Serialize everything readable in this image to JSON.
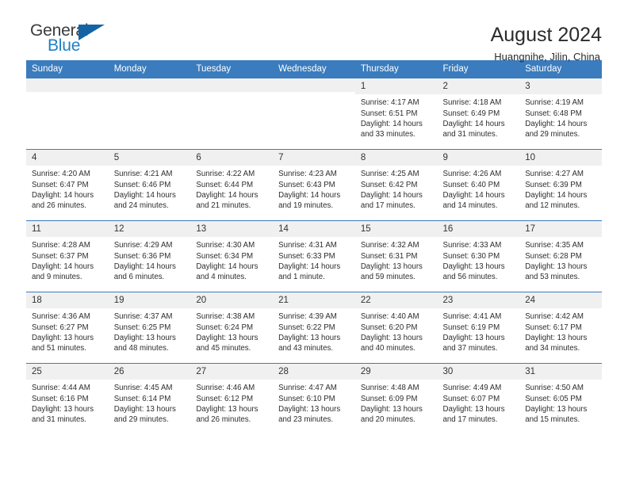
{
  "brand": {
    "name_top": "General",
    "name_bottom": "Blue",
    "triangle_icon": "triangle-icon",
    "accent_color": "#1464a5",
    "blue_text_color": "#1f7fc4"
  },
  "header": {
    "title": "August 2024",
    "subtitle": "Huangnihe, Jilin, China"
  },
  "calendar": {
    "header_bg": "#3a7cbe",
    "daynum_bg": "#f0f0f0",
    "weekdays": [
      "Sunday",
      "Monday",
      "Tuesday",
      "Wednesday",
      "Thursday",
      "Friday",
      "Saturday"
    ],
    "labels": {
      "sunrise": "Sunrise:",
      "sunset": "Sunset:",
      "daylight": "Daylight:"
    },
    "weeks": [
      [
        {
          "day": ""
        },
        {
          "day": ""
        },
        {
          "day": ""
        },
        {
          "day": ""
        },
        {
          "day": "1",
          "sunrise": "Sunrise: 4:17 AM",
          "sunset": "Sunset: 6:51 PM",
          "daylight": "Daylight: 14 hours and 33 minutes."
        },
        {
          "day": "2",
          "sunrise": "Sunrise: 4:18 AM",
          "sunset": "Sunset: 6:49 PM",
          "daylight": "Daylight: 14 hours and 31 minutes."
        },
        {
          "day": "3",
          "sunrise": "Sunrise: 4:19 AM",
          "sunset": "Sunset: 6:48 PM",
          "daylight": "Daylight: 14 hours and 29 minutes."
        }
      ],
      [
        {
          "day": "4",
          "sunrise": "Sunrise: 4:20 AM",
          "sunset": "Sunset: 6:47 PM",
          "daylight": "Daylight: 14 hours and 26 minutes."
        },
        {
          "day": "5",
          "sunrise": "Sunrise: 4:21 AM",
          "sunset": "Sunset: 6:46 PM",
          "daylight": "Daylight: 14 hours and 24 minutes."
        },
        {
          "day": "6",
          "sunrise": "Sunrise: 4:22 AM",
          "sunset": "Sunset: 6:44 PM",
          "daylight": "Daylight: 14 hours and 21 minutes."
        },
        {
          "day": "7",
          "sunrise": "Sunrise: 4:23 AM",
          "sunset": "Sunset: 6:43 PM",
          "daylight": "Daylight: 14 hours and 19 minutes."
        },
        {
          "day": "8",
          "sunrise": "Sunrise: 4:25 AM",
          "sunset": "Sunset: 6:42 PM",
          "daylight": "Daylight: 14 hours and 17 minutes."
        },
        {
          "day": "9",
          "sunrise": "Sunrise: 4:26 AM",
          "sunset": "Sunset: 6:40 PM",
          "daylight": "Daylight: 14 hours and 14 minutes."
        },
        {
          "day": "10",
          "sunrise": "Sunrise: 4:27 AM",
          "sunset": "Sunset: 6:39 PM",
          "daylight": "Daylight: 14 hours and 12 minutes."
        }
      ],
      [
        {
          "day": "11",
          "sunrise": "Sunrise: 4:28 AM",
          "sunset": "Sunset: 6:37 PM",
          "daylight": "Daylight: 14 hours and 9 minutes."
        },
        {
          "day": "12",
          "sunrise": "Sunrise: 4:29 AM",
          "sunset": "Sunset: 6:36 PM",
          "daylight": "Daylight: 14 hours and 6 minutes."
        },
        {
          "day": "13",
          "sunrise": "Sunrise: 4:30 AM",
          "sunset": "Sunset: 6:34 PM",
          "daylight": "Daylight: 14 hours and 4 minutes."
        },
        {
          "day": "14",
          "sunrise": "Sunrise: 4:31 AM",
          "sunset": "Sunset: 6:33 PM",
          "daylight": "Daylight: 14 hours and 1 minute."
        },
        {
          "day": "15",
          "sunrise": "Sunrise: 4:32 AM",
          "sunset": "Sunset: 6:31 PM",
          "daylight": "Daylight: 13 hours and 59 minutes."
        },
        {
          "day": "16",
          "sunrise": "Sunrise: 4:33 AM",
          "sunset": "Sunset: 6:30 PM",
          "daylight": "Daylight: 13 hours and 56 minutes."
        },
        {
          "day": "17",
          "sunrise": "Sunrise: 4:35 AM",
          "sunset": "Sunset: 6:28 PM",
          "daylight": "Daylight: 13 hours and 53 minutes."
        }
      ],
      [
        {
          "day": "18",
          "sunrise": "Sunrise: 4:36 AM",
          "sunset": "Sunset: 6:27 PM",
          "daylight": "Daylight: 13 hours and 51 minutes."
        },
        {
          "day": "19",
          "sunrise": "Sunrise: 4:37 AM",
          "sunset": "Sunset: 6:25 PM",
          "daylight": "Daylight: 13 hours and 48 minutes."
        },
        {
          "day": "20",
          "sunrise": "Sunrise: 4:38 AM",
          "sunset": "Sunset: 6:24 PM",
          "daylight": "Daylight: 13 hours and 45 minutes."
        },
        {
          "day": "21",
          "sunrise": "Sunrise: 4:39 AM",
          "sunset": "Sunset: 6:22 PM",
          "daylight": "Daylight: 13 hours and 43 minutes."
        },
        {
          "day": "22",
          "sunrise": "Sunrise: 4:40 AM",
          "sunset": "Sunset: 6:20 PM",
          "daylight": "Daylight: 13 hours and 40 minutes."
        },
        {
          "day": "23",
          "sunrise": "Sunrise: 4:41 AM",
          "sunset": "Sunset: 6:19 PM",
          "daylight": "Daylight: 13 hours and 37 minutes."
        },
        {
          "day": "24",
          "sunrise": "Sunrise: 4:42 AM",
          "sunset": "Sunset: 6:17 PM",
          "daylight": "Daylight: 13 hours and 34 minutes."
        }
      ],
      [
        {
          "day": "25",
          "sunrise": "Sunrise: 4:44 AM",
          "sunset": "Sunset: 6:16 PM",
          "daylight": "Daylight: 13 hours and 31 minutes."
        },
        {
          "day": "26",
          "sunrise": "Sunrise: 4:45 AM",
          "sunset": "Sunset: 6:14 PM",
          "daylight": "Daylight: 13 hours and 29 minutes."
        },
        {
          "day": "27",
          "sunrise": "Sunrise: 4:46 AM",
          "sunset": "Sunset: 6:12 PM",
          "daylight": "Daylight: 13 hours and 26 minutes."
        },
        {
          "day": "28",
          "sunrise": "Sunrise: 4:47 AM",
          "sunset": "Sunset: 6:10 PM",
          "daylight": "Daylight: 13 hours and 23 minutes."
        },
        {
          "day": "29",
          "sunrise": "Sunrise: 4:48 AM",
          "sunset": "Sunset: 6:09 PM",
          "daylight": "Daylight: 13 hours and 20 minutes."
        },
        {
          "day": "30",
          "sunrise": "Sunrise: 4:49 AM",
          "sunset": "Sunset: 6:07 PM",
          "daylight": "Daylight: 13 hours and 17 minutes."
        },
        {
          "day": "31",
          "sunrise": "Sunrise: 4:50 AM",
          "sunset": "Sunset: 6:05 PM",
          "daylight": "Daylight: 13 hours and 15 minutes."
        }
      ]
    ]
  }
}
